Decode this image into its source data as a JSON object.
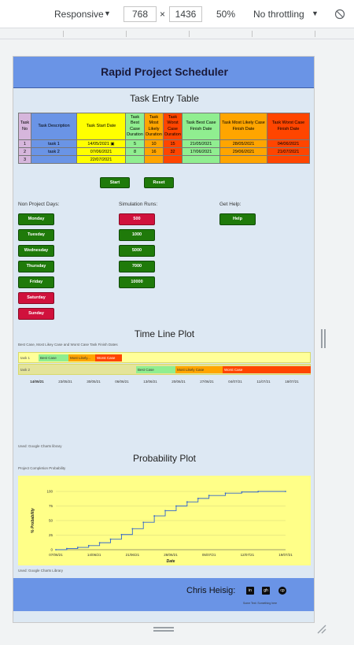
{
  "devtools": {
    "device": "Responsive",
    "width": "768",
    "times": "×",
    "height": "1436",
    "zoom": "50%",
    "throttle": "No throttling"
  },
  "app": {
    "title": "Rapid Project Scheduler",
    "task_table_title": "Task Entry Table",
    "headers": [
      "Task No",
      "Task Description",
      "Task Start Date",
      "Task Best Case Duration",
      "Task Most Likely Duration",
      "Task Worst Case Duration",
      "Task Best Case Finish Date",
      "Task Most Likely Case Finish Date",
      "Task Worst Case Finish Date"
    ],
    "rows": [
      {
        "no": "1",
        "desc": "task 1",
        "start": "14/05/2021",
        "best": "5",
        "likely": "10",
        "worst": "15",
        "best_finish": "21/05/2021",
        "likely_finish": "28/05/2021",
        "worst_finish": "04/06/2021"
      },
      {
        "no": "2",
        "desc": "task 2",
        "start": "07/06/2021",
        "best": "8",
        "likely": "16",
        "worst": "32",
        "best_finish": "17/06/2021",
        "likely_finish": "29/06/2021",
        "worst_finish": "21/07/2021"
      },
      {
        "no": "3",
        "desc": "",
        "start": "22/07/2021",
        "best": "",
        "likely": "",
        "worst": "",
        "best_finish": "",
        "likely_finish": "",
        "worst_finish": ""
      }
    ],
    "start_button": "Start",
    "reset_button": "Reset",
    "non_project_label": "Non Project Days:",
    "days": [
      "Monday",
      "Tuesday",
      "Wednesday",
      "Thursday",
      "Friday",
      "Saturday",
      "Sunday"
    ],
    "simulation_label": "Simulation Runs:",
    "runs": [
      "500",
      "1000",
      "5000",
      "7000",
      "10000"
    ],
    "help_label": "Get Help:",
    "help_button": "Help",
    "timeline_title": "Time Line Plot",
    "timeline_subtitle": "Best Case, Most Likey Case and Worst Case Task Finish Dates",
    "timeline_rows": [
      {
        "label": "task 1",
        "bars": [
          "Best Case",
          "Most Likely...",
          "Worst Case"
        ]
      },
      {
        "label": "task 2",
        "bars": [
          "Best Case",
          "Most Likely Case",
          "Worst Case"
        ]
      }
    ],
    "timeline_ticks": [
      "14/05/21",
      "23/05/21",
      "30/05/21",
      "06/06/21",
      "13/06/21",
      "20/06/21",
      "27/06/21",
      "04/07/21",
      "11/07/21",
      "18/07/21"
    ],
    "timeline_credit": "Used: Google Charts library",
    "prob_title": "Probability Plot",
    "prob_subtitle": "Project Completion Probability",
    "prob_credit": "Used: Google Charts Library",
    "footer_name": "Chris Heisig:",
    "footer_icons": [
      "in",
      "gh",
      "cp"
    ],
    "footer_note": "Some Text: Something here"
  },
  "colors": {
    "header": "#6a94e6",
    "best": "#90ee90",
    "likely": "#ffa500",
    "worst": "#ff4500",
    "start": "#ffff00",
    "button_green": "#1f7a0a",
    "button_red": "#d0113c"
  },
  "chart_data": {
    "type": "line",
    "title": "",
    "xlabel": "Date",
    "ylabel": "% Probability",
    "x_ticks": [
      "07/06/21",
      "14/06/21",
      "21/06/21",
      "28/06/21",
      "05/07/21",
      "12/07/21",
      "19/07/21"
    ],
    "y_ticks": [
      "0",
      "25",
      "50",
      "75",
      "100"
    ],
    "ylim": [
      0,
      100
    ],
    "grid": true,
    "series": [
      {
        "x": [
          "07/06/21",
          "09/06/21",
          "11/06/21",
          "13/06/21",
          "15/06/21",
          "17/06/21",
          "19/06/21",
          "21/06/21",
          "23/06/21",
          "25/06/21",
          "27/06/21",
          "29/06/21",
          "01/07/21",
          "03/07/21",
          "05/07/21",
          "08/07/21",
          "11/07/21",
          "14/07/21",
          "19/07/21"
        ],
        "values": [
          0,
          2,
          4,
          7,
          12,
          18,
          26,
          36,
          47,
          58,
          67,
          75,
          82,
          88,
          93,
          97,
          99,
          100,
          100
        ]
      }
    ]
  }
}
